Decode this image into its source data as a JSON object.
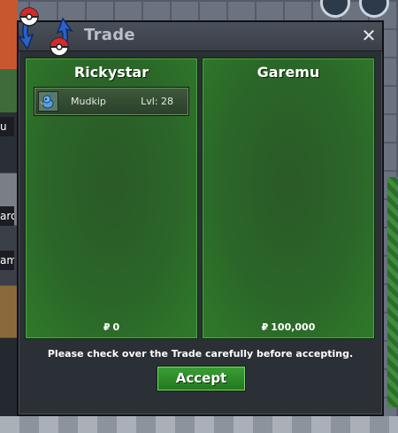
{
  "window": {
    "title": "Trade",
    "close_glyph": "✕",
    "logo_icon": "pokeball-trade-arrows-icon"
  },
  "trade": {
    "left": {
      "trainer": "Rickystar",
      "items": [
        {
          "name": "Mudkip",
          "level": "Lvl: 28",
          "icon": "mudkip-sprite-icon"
        }
      ],
      "money_symbol": "₽",
      "money": "0"
    },
    "right": {
      "trainer": "Garemu",
      "items": [],
      "money_symbol": "₽",
      "money": "100,000"
    },
    "notice": "Please check over the Trade carefully before accepting.",
    "accept_label": "Accept"
  },
  "background": {
    "side_labels": [
      "u",
      "ard",
      "am"
    ]
  },
  "colors": {
    "panel_green": "#2b6628",
    "accept_green": "#2f8b2a",
    "window_bg": "#2b2f36"
  }
}
